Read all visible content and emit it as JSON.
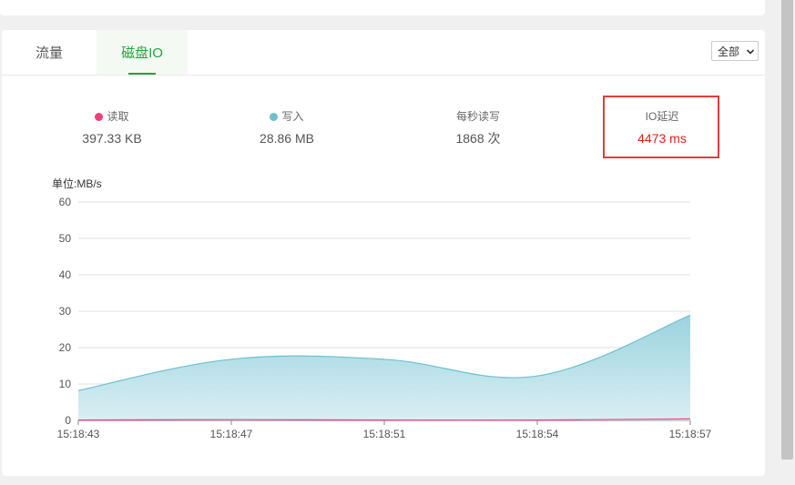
{
  "tabs": {
    "flow": "流量",
    "disk_io": "磁盘IO",
    "active": "disk_io"
  },
  "filter": {
    "selected": "全部"
  },
  "stats": {
    "read": {
      "label": "读取",
      "value": "397.33 KB",
      "color": "#f0407a"
    },
    "write": {
      "label": "写入",
      "value": "28.86 MB",
      "color": "#6cc0cf"
    },
    "ops": {
      "label": "每秒读写",
      "value": "1868 次"
    },
    "latency": {
      "label": "IO延迟",
      "value": "4473 ms",
      "color": "#e0211e"
    }
  },
  "chart_unit": "单位:MB/s",
  "chart_data": {
    "type": "area",
    "ylabel": "单位:MB/s",
    "ylim": [
      0,
      60
    ],
    "yticks": [
      0,
      10,
      20,
      30,
      40,
      50,
      60
    ],
    "grid": true,
    "categories": [
      "15:18:43",
      "15:18:47",
      "15:18:51",
      "15:18:54",
      "15:18:57"
    ],
    "series": [
      {
        "name": "写入",
        "values": [
          8.2,
          16.8,
          16.8,
          12.2,
          28.9
        ],
        "color": "#6cc0cf"
      },
      {
        "name": "读取",
        "values": [
          0.1,
          0.2,
          0.1,
          0.1,
          0.4
        ],
        "color": "#f0407a"
      }
    ]
  }
}
